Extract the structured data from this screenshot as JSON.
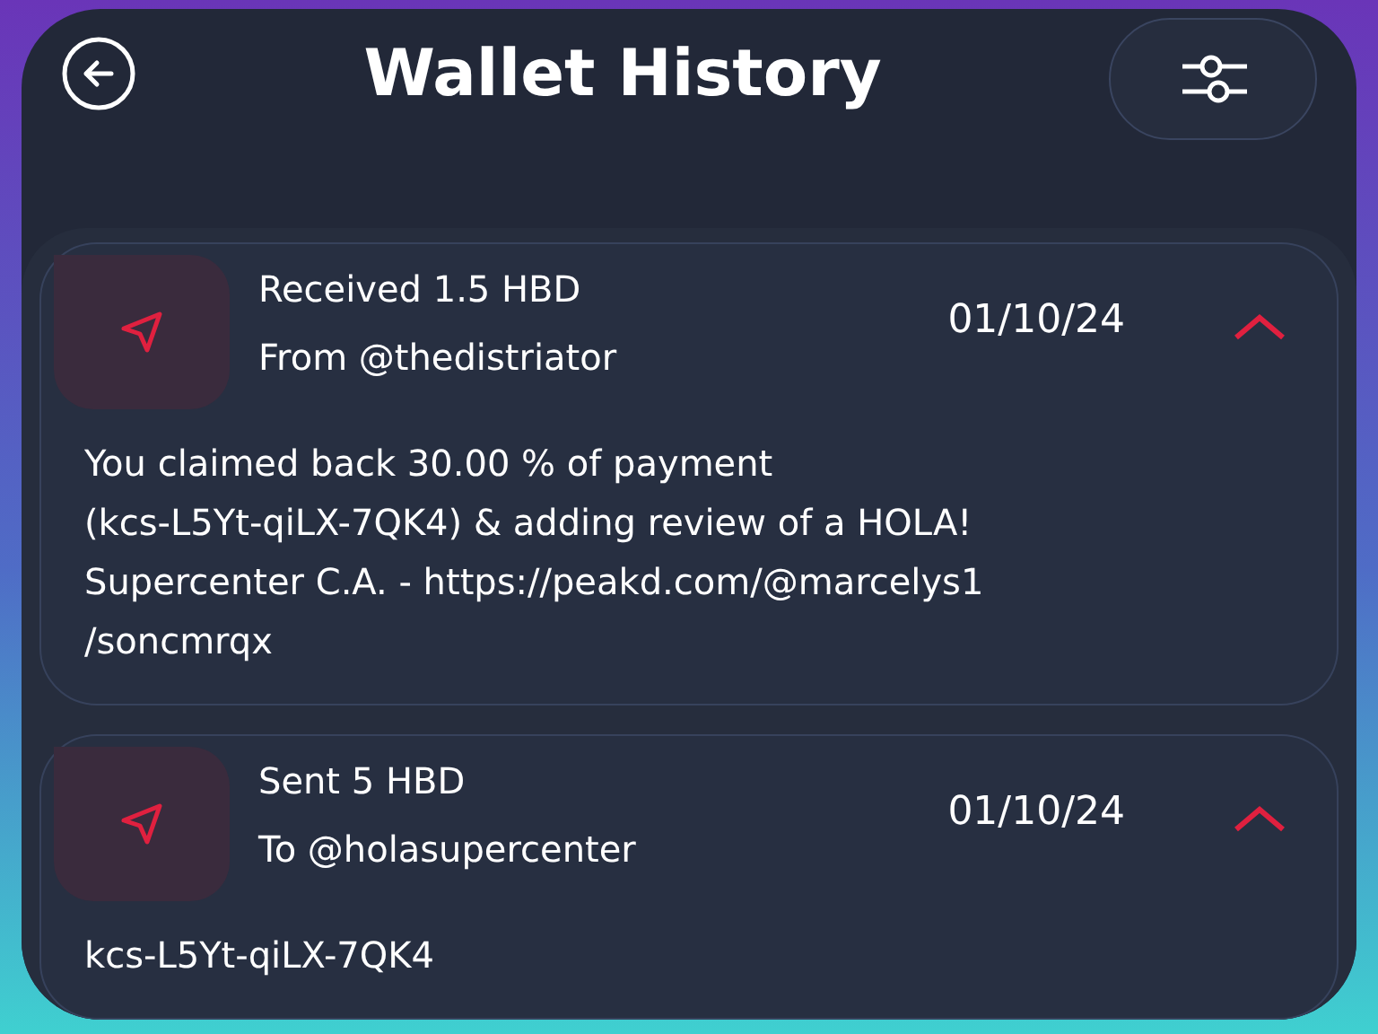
{
  "header": {
    "title": "Wallet History"
  },
  "transactions": [
    {
      "kind": "sent",
      "title": "Received 1.5 HBD",
      "party": "From @thedistriator",
      "date": "01/10/24",
      "expanded": true,
      "memo": "You claimed back 30.00 % of payment\n(kcs-L5Yt-qiLX-7QK4) & adding review of a HOLA!\nSupercenter C.A. - https://peakd.com/@marcelys1\n/soncmrqx"
    },
    {
      "kind": "sent",
      "title": "Sent 5 HBD",
      "party": "To @holasupercenter",
      "date": "01/10/24",
      "expanded": true,
      "memo": "kcs-L5Yt-qiLX-7QK4"
    }
  ]
}
